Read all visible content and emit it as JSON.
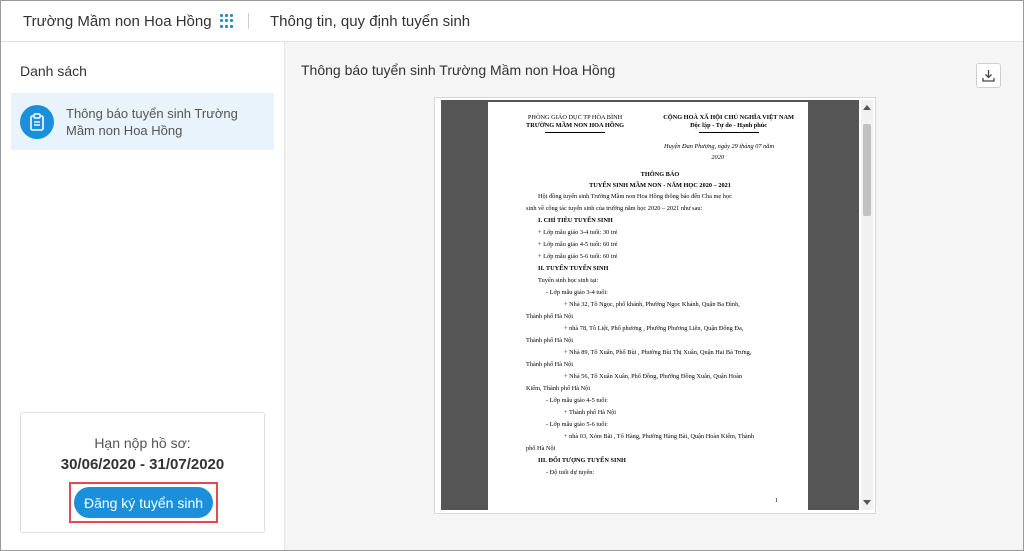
{
  "header": {
    "school_name": "Trường Mầm non Hoa Hồng",
    "page_title": "Thông tin, quy định tuyển sinh",
    "apps_icon": "grid-apps-icon"
  },
  "sidebar": {
    "title": "Danh sách",
    "items": [
      {
        "label": "Thông báo tuyển sinh Trường Mầm non Hoa Hồng",
        "icon": "clipboard-icon",
        "selected": true
      }
    ],
    "deadline": {
      "label": "Hạn nộp hồ sơ:",
      "dates": "30/06/2020 - 31/07/2020"
    },
    "register_button": "Đăng ký tuyển sinh"
  },
  "main": {
    "document_title": "Thông báo tuyển sinh Trường Mầm non Hoa Hồng",
    "download_icon": "download-icon"
  },
  "document": {
    "left_header_1": "PHÒNG GIÁO DỤC TP HÒA BÌNH",
    "left_header_2": "TRƯỜNG MẦM NON HOA HỒNG",
    "right_header_1": "CỘNG HOÀ XÃ HỘI CHỦ NGHĨA VIỆT NAM",
    "right_header_2": "Độc lập - Tự do - Hạnh phúc",
    "place_date_1": "Huyện Đan Phượng, ngày 29 tháng 07 năm",
    "place_date_2": "2020",
    "heading_1": "THÔNG BÁO",
    "heading_2": "TUYỂN SINH MẦM NON - NĂM HỌC 2020 – 2021",
    "intro_1": "Hội đồng tuyển sinh Trường Mầm non Hoa Hồng thông báo đến Cha mẹ học",
    "intro_2": "sinh về công tác tuyển sinh của trường năm học 2020 – 2021 như sau:",
    "section_1": "I. CHỈ TIÊU TUYỂN SINH",
    "quota_1": "+ Lớp mẫu giáo 3-4 tuổi: 30 trẻ",
    "quota_2": "+ Lớp mẫu giáo 4-5 tuổi: 60 trẻ",
    "quota_3": "+ Lớp mẫu giáo 5-6 tuổi: 60 trẻ",
    "section_2": "II. TUYỂN TUYỂN SINH",
    "enroll_at": "Tuyển sinh học sinh tại:",
    "class_a": "- Lớp mẫu giáo 3-4 tuổi:",
    "addr_a1_1": "+ Nhà 32, Tô Ngọc, phố khánh, Phường Ngọc Khánh, Quận Ba Đình,",
    "addr_a1_2": "Thành phố Hà Nội",
    "addr_a2_1": "+ nhà 78, Tô Liệt, Phố phương , Phường Phương Liên, Quận Đống Đa,",
    "addr_a2_2": "Thành phố Hà Nội",
    "addr_a3_1": "+ Nhà 89, Tô Xuân, Phố Bùi , Phường Bùi Thị Xuân, Quận Hai Bà Trưng,",
    "addr_a3_2": "Thành phố Hà Nội",
    "addr_a4_1": "+ Nhà 56, Tô Xuân Xuân, Phố Đồng, Phường Đồng Xuân, Quận Hoàn",
    "addr_a4_2": "Kiếm, Thành phố Hà Nội",
    "class_b": "- Lớp mẫu giáo 4-5 tuổi:",
    "addr_b1": "+ Thành phố Hà Nội",
    "class_c": "- Lớp mẫu giáo 5-6 tuổi:",
    "addr_c1_1": "+ nhà 03, Xóm Bãi , Tổ Hàng, Phường Hàng Bài, Quận Hoàn Kiếm, Thành",
    "addr_c1_2": "phố Hà Nội",
    "section_3": "III. ĐỐI TƯỢNG TUYỂN SINH",
    "age_line": "- Độ tuổi dự tuyển:",
    "page_number": "1"
  }
}
